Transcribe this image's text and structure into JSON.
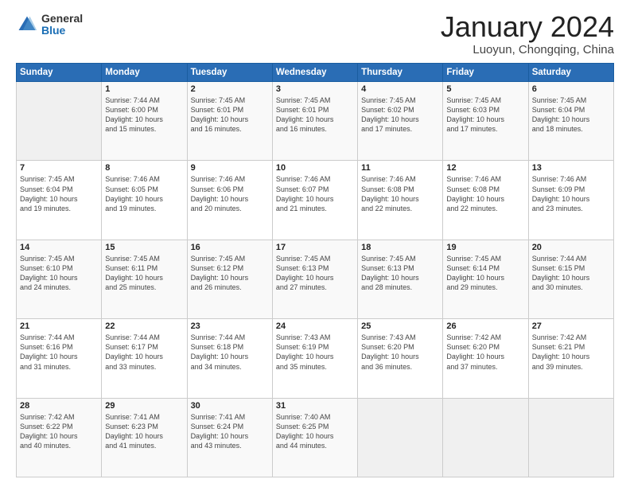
{
  "logo": {
    "general": "General",
    "blue": "Blue"
  },
  "header": {
    "month": "January 2024",
    "location": "Luoyun, Chongqing, China"
  },
  "weekdays": [
    "Sunday",
    "Monday",
    "Tuesday",
    "Wednesday",
    "Thursday",
    "Friday",
    "Saturday"
  ],
  "weeks": [
    [
      {
        "day": "",
        "info": ""
      },
      {
        "day": "1",
        "info": "Sunrise: 7:44 AM\nSunset: 6:00 PM\nDaylight: 10 hours\nand 15 minutes."
      },
      {
        "day": "2",
        "info": "Sunrise: 7:45 AM\nSunset: 6:01 PM\nDaylight: 10 hours\nand 16 minutes."
      },
      {
        "day": "3",
        "info": "Sunrise: 7:45 AM\nSunset: 6:01 PM\nDaylight: 10 hours\nand 16 minutes."
      },
      {
        "day": "4",
        "info": "Sunrise: 7:45 AM\nSunset: 6:02 PM\nDaylight: 10 hours\nand 17 minutes."
      },
      {
        "day": "5",
        "info": "Sunrise: 7:45 AM\nSunset: 6:03 PM\nDaylight: 10 hours\nand 17 minutes."
      },
      {
        "day": "6",
        "info": "Sunrise: 7:45 AM\nSunset: 6:04 PM\nDaylight: 10 hours\nand 18 minutes."
      }
    ],
    [
      {
        "day": "7",
        "info": "Sunrise: 7:45 AM\nSunset: 6:04 PM\nDaylight: 10 hours\nand 19 minutes."
      },
      {
        "day": "8",
        "info": "Sunrise: 7:46 AM\nSunset: 6:05 PM\nDaylight: 10 hours\nand 19 minutes."
      },
      {
        "day": "9",
        "info": "Sunrise: 7:46 AM\nSunset: 6:06 PM\nDaylight: 10 hours\nand 20 minutes."
      },
      {
        "day": "10",
        "info": "Sunrise: 7:46 AM\nSunset: 6:07 PM\nDaylight: 10 hours\nand 21 minutes."
      },
      {
        "day": "11",
        "info": "Sunrise: 7:46 AM\nSunset: 6:08 PM\nDaylight: 10 hours\nand 22 minutes."
      },
      {
        "day": "12",
        "info": "Sunrise: 7:46 AM\nSunset: 6:08 PM\nDaylight: 10 hours\nand 22 minutes."
      },
      {
        "day": "13",
        "info": "Sunrise: 7:46 AM\nSunset: 6:09 PM\nDaylight: 10 hours\nand 23 minutes."
      }
    ],
    [
      {
        "day": "14",
        "info": "Sunrise: 7:45 AM\nSunset: 6:10 PM\nDaylight: 10 hours\nand 24 minutes."
      },
      {
        "day": "15",
        "info": "Sunrise: 7:45 AM\nSunset: 6:11 PM\nDaylight: 10 hours\nand 25 minutes."
      },
      {
        "day": "16",
        "info": "Sunrise: 7:45 AM\nSunset: 6:12 PM\nDaylight: 10 hours\nand 26 minutes."
      },
      {
        "day": "17",
        "info": "Sunrise: 7:45 AM\nSunset: 6:13 PM\nDaylight: 10 hours\nand 27 minutes."
      },
      {
        "day": "18",
        "info": "Sunrise: 7:45 AM\nSunset: 6:13 PM\nDaylight: 10 hours\nand 28 minutes."
      },
      {
        "day": "19",
        "info": "Sunrise: 7:45 AM\nSunset: 6:14 PM\nDaylight: 10 hours\nand 29 minutes."
      },
      {
        "day": "20",
        "info": "Sunrise: 7:44 AM\nSunset: 6:15 PM\nDaylight: 10 hours\nand 30 minutes."
      }
    ],
    [
      {
        "day": "21",
        "info": "Sunrise: 7:44 AM\nSunset: 6:16 PM\nDaylight: 10 hours\nand 31 minutes."
      },
      {
        "day": "22",
        "info": "Sunrise: 7:44 AM\nSunset: 6:17 PM\nDaylight: 10 hours\nand 33 minutes."
      },
      {
        "day": "23",
        "info": "Sunrise: 7:44 AM\nSunset: 6:18 PM\nDaylight: 10 hours\nand 34 minutes."
      },
      {
        "day": "24",
        "info": "Sunrise: 7:43 AM\nSunset: 6:19 PM\nDaylight: 10 hours\nand 35 minutes."
      },
      {
        "day": "25",
        "info": "Sunrise: 7:43 AM\nSunset: 6:20 PM\nDaylight: 10 hours\nand 36 minutes."
      },
      {
        "day": "26",
        "info": "Sunrise: 7:42 AM\nSunset: 6:20 PM\nDaylight: 10 hours\nand 37 minutes."
      },
      {
        "day": "27",
        "info": "Sunrise: 7:42 AM\nSunset: 6:21 PM\nDaylight: 10 hours\nand 39 minutes."
      }
    ],
    [
      {
        "day": "28",
        "info": "Sunrise: 7:42 AM\nSunset: 6:22 PM\nDaylight: 10 hours\nand 40 minutes."
      },
      {
        "day": "29",
        "info": "Sunrise: 7:41 AM\nSunset: 6:23 PM\nDaylight: 10 hours\nand 41 minutes."
      },
      {
        "day": "30",
        "info": "Sunrise: 7:41 AM\nSunset: 6:24 PM\nDaylight: 10 hours\nand 43 minutes."
      },
      {
        "day": "31",
        "info": "Sunrise: 7:40 AM\nSunset: 6:25 PM\nDaylight: 10 hours\nand 44 minutes."
      },
      {
        "day": "",
        "info": ""
      },
      {
        "day": "",
        "info": ""
      },
      {
        "day": "",
        "info": ""
      }
    ]
  ]
}
